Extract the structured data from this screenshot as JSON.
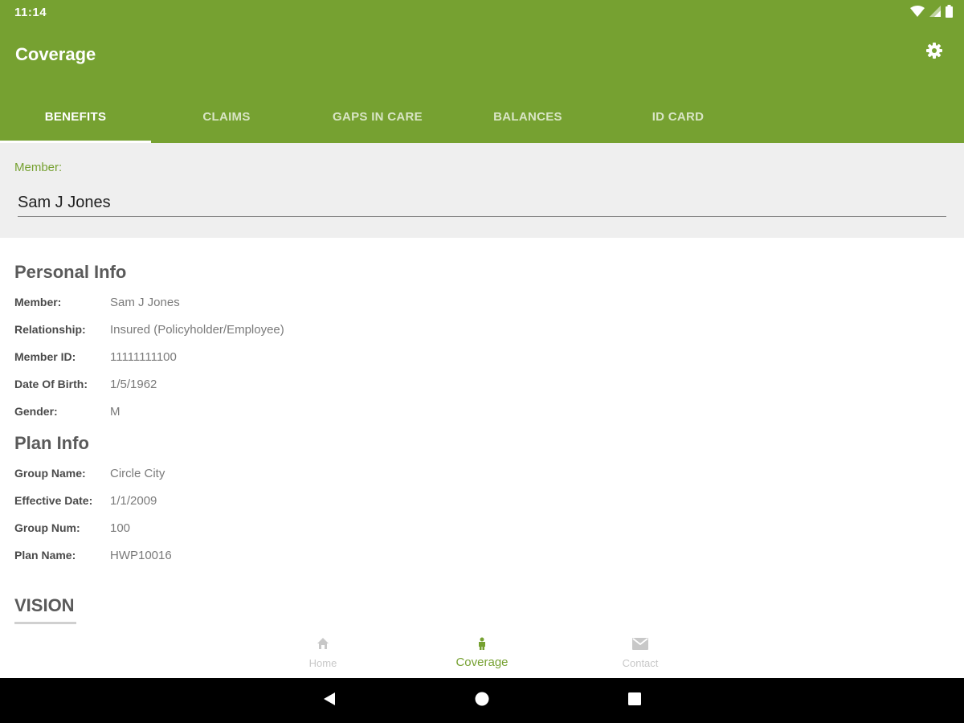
{
  "status_bar": {
    "time": "11:14",
    "icons": [
      "wifi-icon",
      "signal-icon",
      "battery-icon"
    ]
  },
  "toolbar": {
    "title": "Coverage",
    "settings_icon": "gear-icon"
  },
  "tabs": [
    {
      "label": "BENEFITS",
      "active": true
    },
    {
      "label": "CLAIMS",
      "active": false
    },
    {
      "label": "GAPS IN CARE",
      "active": false
    },
    {
      "label": "BALANCES",
      "active": false
    },
    {
      "label": "ID CARD",
      "active": false
    }
  ],
  "member_selector": {
    "label": "Member:",
    "value": "Sam J Jones"
  },
  "personal_info": {
    "title": "Personal Info",
    "rows": [
      {
        "label": "Member:",
        "value": "Sam J Jones"
      },
      {
        "label": "Relationship:",
        "value": "Insured (Policyholder/Employee)"
      },
      {
        "label": "Member ID:",
        "value": "11111111100"
      },
      {
        "label": "Date Of Birth:",
        "value": "1/5/1962"
      },
      {
        "label": "Gender:",
        "value": "M"
      }
    ]
  },
  "plan_info": {
    "title": "Plan Info",
    "rows": [
      {
        "label": "Group Name:",
        "value": "Circle City"
      },
      {
        "label": "Effective Date:",
        "value": "1/1/2009"
      },
      {
        "label": "Group Num:",
        "value": "100"
      },
      {
        "label": "Plan Name:",
        "value": "HWP10016"
      }
    ]
  },
  "vision": {
    "title": "VISION"
  },
  "bottom_nav": [
    {
      "label": "Home",
      "icon": "home-icon",
      "active": false
    },
    {
      "label": "Coverage",
      "icon": "coverage-icon",
      "active": true
    },
    {
      "label": "Contact",
      "icon": "mail-icon",
      "active": false
    }
  ],
  "colors": {
    "brand": "#76a131",
    "section_bg": "#efefef",
    "system_nav": "#000000"
  }
}
